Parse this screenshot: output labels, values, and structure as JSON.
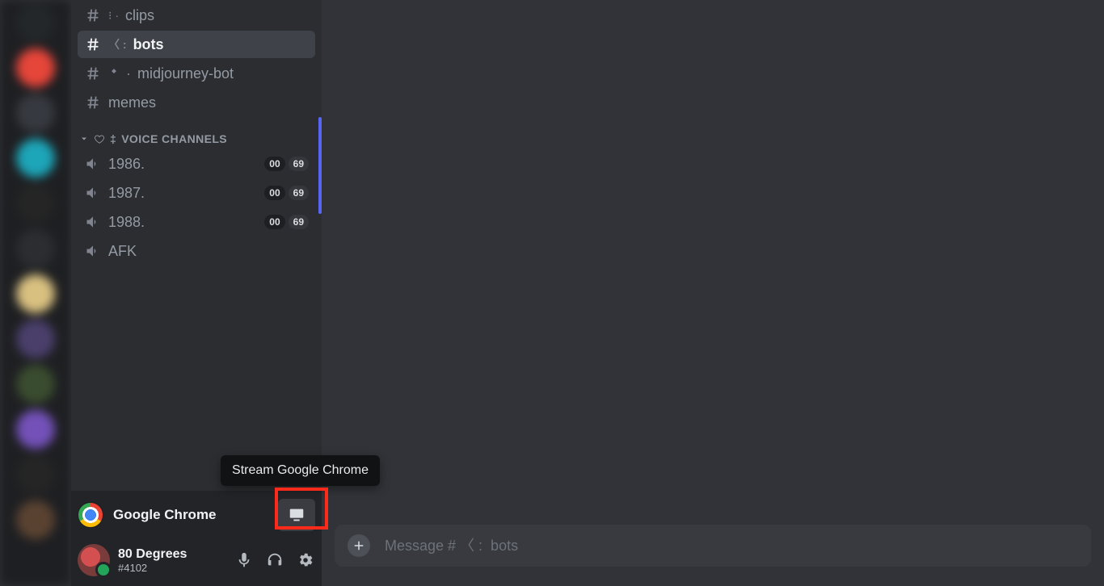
{
  "sidebar": {
    "text_channels": [
      {
        "name": "clips",
        "extra": "⁝ ·",
        "selected": false
      },
      {
        "name": "bots",
        "extra": "〈 :",
        "selected": true
      },
      {
        "name": "midjourney-bot",
        "extra": "◈ ·",
        "selected": false
      },
      {
        "name": "memes",
        "extra": "",
        "selected": false
      }
    ],
    "voice_category_label": "VOICE CHANNELS",
    "voice_channels": [
      {
        "name": "1986.",
        "badge1": "00",
        "badge2": "69"
      },
      {
        "name": "1987.",
        "badge1": "00",
        "badge2": "69"
      },
      {
        "name": "1988.",
        "badge1": "00",
        "badge2": "69"
      },
      {
        "name": "AFK",
        "badge1": "",
        "badge2": ""
      }
    ]
  },
  "activity": {
    "app_name": "Google Chrome",
    "tooltip": "Stream Google Chrome"
  },
  "user": {
    "name": "80 Degrees",
    "tag": "#4102"
  },
  "composer": {
    "placeholder": "Message # 〈 :  bots"
  }
}
